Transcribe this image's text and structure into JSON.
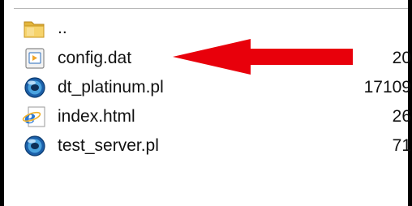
{
  "files": [
    {
      "name": "..",
      "size": "",
      "icon": "folder-icon"
    },
    {
      "name": "config.dat",
      "size": "20",
      "icon": "dat-file-icon"
    },
    {
      "name": "dt_platinum.pl",
      "size": "17109",
      "icon": "perl-file-icon"
    },
    {
      "name": "index.html",
      "size": "26",
      "icon": "html-file-icon"
    },
    {
      "name": "test_server.pl",
      "size": "71",
      "icon": "perl-file-icon"
    }
  ],
  "annotation": {
    "arrow_color": "#e8000b",
    "points_to": "config.dat"
  }
}
